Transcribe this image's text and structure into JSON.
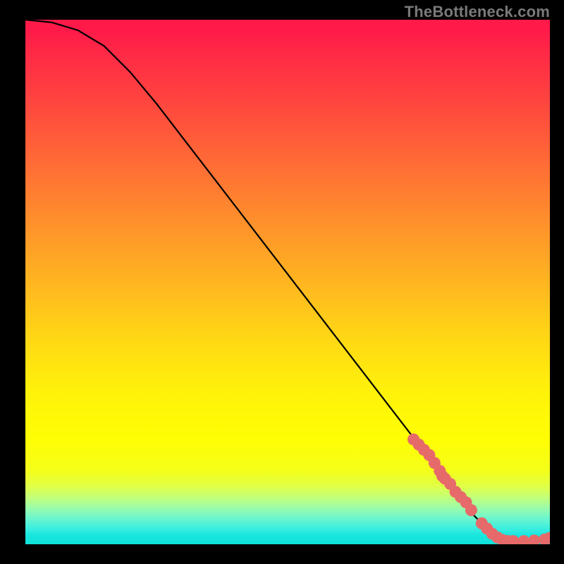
{
  "watermark": "TheBottleneck.com",
  "chart_data": {
    "type": "line",
    "title": "",
    "xlabel": "",
    "ylabel": "",
    "xlim": [
      0,
      100
    ],
    "ylim": [
      0,
      100
    ],
    "series": [
      {
        "name": "bottleneck-curve",
        "x": [
          0,
          5,
          10,
          15,
          20,
          25,
          30,
          35,
          40,
          45,
          50,
          55,
          60,
          65,
          70,
          75,
          80,
          85,
          90,
          92,
          95,
          98,
          100
        ],
        "values": [
          100,
          99.5,
          98,
          95,
          90,
          84,
          77.5,
          71,
          64.5,
          58,
          51.5,
          45,
          38.5,
          32,
          25.5,
          19,
          12.5,
          6,
          1,
          0.6,
          0.6,
          0.8,
          1.2
        ]
      }
    ],
    "markers": {
      "name": "dense-segment",
      "x": [
        74,
        75,
        76,
        77,
        78,
        79,
        79.5,
        80,
        81,
        82,
        83,
        84,
        85,
        87,
        88,
        89,
        90,
        91,
        92,
        93,
        95,
        97,
        99,
        100
      ],
      "values": [
        20,
        19,
        18,
        17,
        15.5,
        14,
        13,
        12.5,
        11.5,
        10,
        9,
        8,
        6.5,
        4,
        3,
        2,
        1.3,
        0.8,
        0.6,
        0.6,
        0.6,
        0.7,
        0.9,
        1.2
      ]
    },
    "colors": {
      "curve": "#000000",
      "marker_fill": "#e76a6a",
      "marker_stroke": "#d85a5a"
    }
  }
}
